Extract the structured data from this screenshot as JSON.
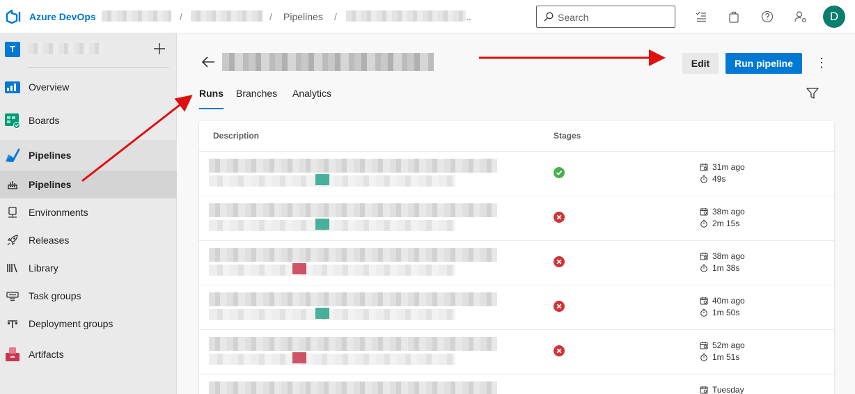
{
  "header": {
    "brand": "Azure DevOps",
    "breadcrumb_separator": "/",
    "breadcrumb_pipelines": "Pipelines",
    "breadcrumb_ellipsis": "..",
    "search_placeholder": "Search",
    "avatar_initial": "D"
  },
  "sidebar": {
    "project_initial": "T",
    "items": [
      {
        "label": "Overview"
      },
      {
        "label": "Boards"
      },
      {
        "label": "Pipelines"
      },
      {
        "label": "Pipelines"
      },
      {
        "label": "Environments"
      },
      {
        "label": "Releases"
      },
      {
        "label": "Library"
      },
      {
        "label": "Task groups"
      },
      {
        "label": "Deployment groups"
      },
      {
        "label": "Artifacts"
      }
    ]
  },
  "page": {
    "edit_label": "Edit",
    "run_label": "Run pipeline",
    "more_label": "⋮",
    "tabs": [
      {
        "label": "Runs"
      },
      {
        "label": "Branches"
      },
      {
        "label": "Analytics"
      }
    ],
    "columns": {
      "description": "Description",
      "stages": "Stages"
    }
  },
  "runs": [
    {
      "status": "succeeded",
      "age": "31m ago",
      "duration": "49s",
      "tag_color": "#2aa58c"
    },
    {
      "status": "failed",
      "age": "38m ago",
      "duration": "2m 15s",
      "tag_color": "#2aa58c"
    },
    {
      "status": "failed",
      "age": "38m ago",
      "duration": "1m 38s",
      "tag_color": "#c8374f"
    },
    {
      "status": "failed",
      "age": "40m ago",
      "duration": "1m 50s",
      "tag_color": "#2aa58c"
    },
    {
      "status": "failed",
      "age": "52m ago",
      "duration": "1m 51s",
      "tag_color": "#c8374f"
    },
    {
      "status": "",
      "age": "Tuesday",
      "duration": "",
      "tag_color": ""
    }
  ],
  "colors": {
    "accent": "#0078d4",
    "success": "#4caf50",
    "failure": "#d13438",
    "annotation_arrow": "#e01010"
  }
}
